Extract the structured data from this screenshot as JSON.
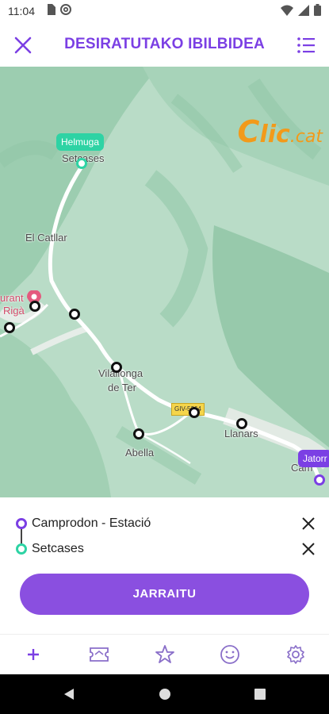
{
  "status_bar": {
    "time": "11:04",
    "icons_left": [
      "sd-card-icon",
      "at-sign-icon"
    ],
    "icons_right": [
      "wifi-icon",
      "signal-icon",
      "battery-icon"
    ]
  },
  "header": {
    "title": "DESIRATUTAKO IBILBIDEA",
    "close_icon": "close-icon",
    "menu_icon": "list-menu-icon",
    "accent_color": "#7b3fe4"
  },
  "map": {
    "labels": {
      "setcases": "Setcases",
      "el_catllar": "El Catllar",
      "vilallonga": "Vilallonga",
      "de_ter": "de Ter",
      "llanars": "Llanars",
      "abella": "Abella",
      "restaurant": "urant",
      "riga": "Rigà",
      "road": "GIV-5264",
      "camprodon_partial": "Cam"
    },
    "destination_label": "Helmuga",
    "origin_label": "Jatorr",
    "watermark": {
      "letter": "C",
      "rest": "lic",
      "suffix": ".cat"
    }
  },
  "route": {
    "origin": "Camprodon - Estació",
    "destination": "Setcases",
    "origin_color": "#7b3fe4",
    "destination_color": "#2ed3a4"
  },
  "continue_button": "JARRAITU",
  "bottom_nav": [
    {
      "icon": "plus-icon"
    },
    {
      "icon": "ticket-icon"
    },
    {
      "icon": "star-icon"
    },
    {
      "icon": "smiley-icon"
    },
    {
      "icon": "settings-gear-icon"
    }
  ]
}
